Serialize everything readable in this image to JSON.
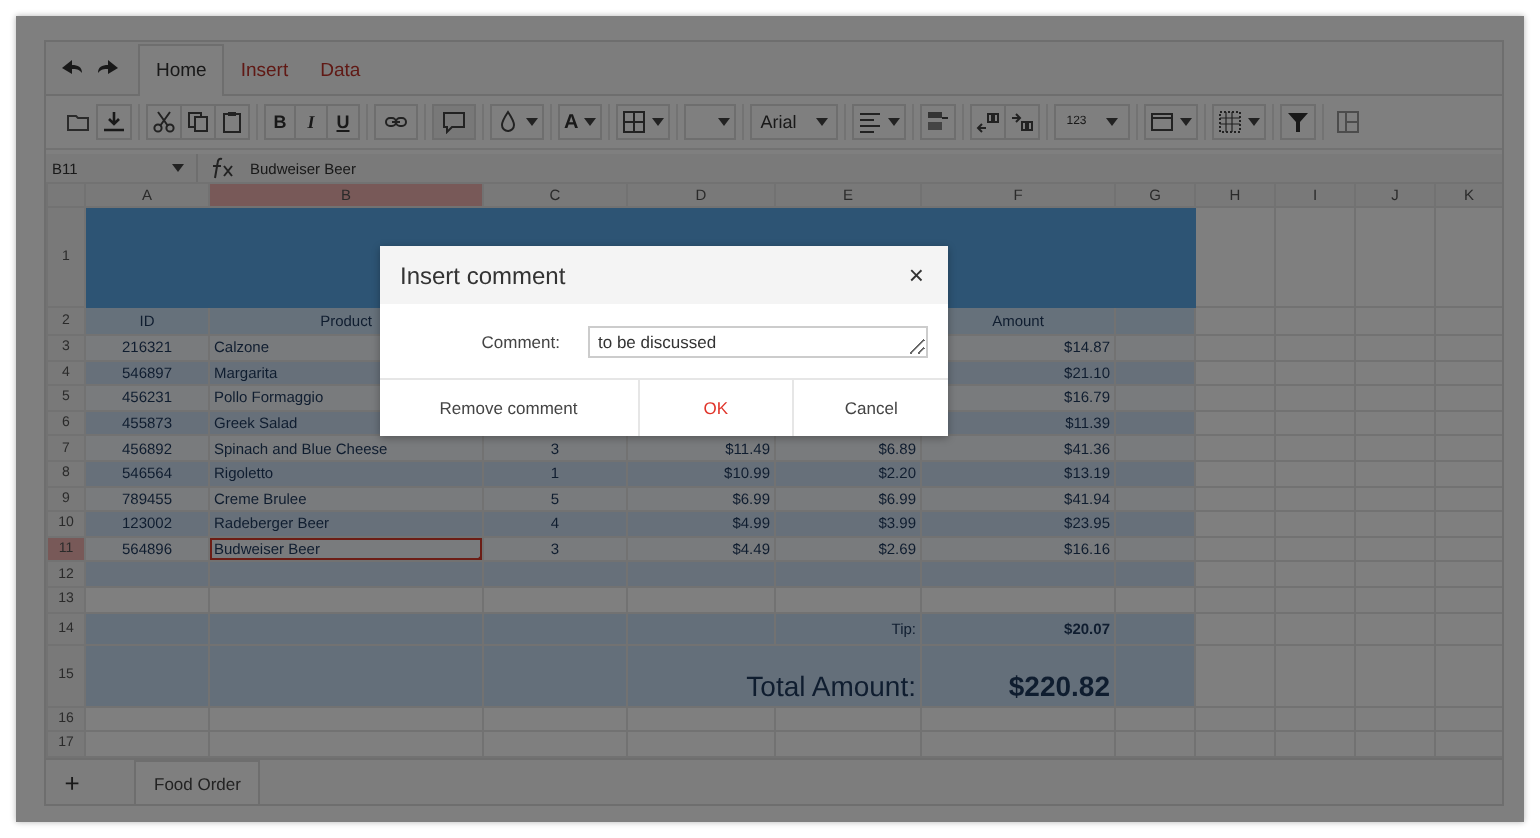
{
  "ribbon_tabs": [
    {
      "label": "Home",
      "selected": true
    },
    {
      "label": "Insert",
      "selected": false
    },
    {
      "label": "Data",
      "selected": false
    }
  ],
  "toolbar": {
    "bold": "B",
    "italic": "I",
    "underline": "U",
    "font_color": "A",
    "font_family": "Arial",
    "number_format": "123"
  },
  "formula_bar": {
    "cell": "B11",
    "formula": "Budweiser Beer"
  },
  "sheet": {
    "columns": [
      {
        "label": "A",
        "selected": false
      },
      {
        "label": "B",
        "selected": true
      },
      {
        "label": "C",
        "selected": false
      },
      {
        "label": "D",
        "selected": false
      },
      {
        "label": "E",
        "selected": false
      },
      {
        "label": "F",
        "selected": false
      },
      {
        "label": "G",
        "selected": false
      },
      {
        "label": "H",
        "selected": false
      },
      {
        "label": "I",
        "selected": false
      },
      {
        "label": "J",
        "selected": false
      },
      {
        "label": "K",
        "selected": false
      }
    ],
    "rows": [
      {
        "label": "1",
        "kind": "title",
        "selected": false,
        "cells": {}
      },
      {
        "label": "2",
        "kind": "header",
        "selected": false,
        "cells": {
          "id": "ID",
          "product": "Product",
          "amount": "Amount"
        }
      },
      {
        "label": "3",
        "kind": "data",
        "selected": false,
        "cells": {
          "id": "216321",
          "product": "Calzone",
          "amount": "$14.87"
        }
      },
      {
        "label": "4",
        "kind": "data",
        "selected": false,
        "cells": {
          "id": "546897",
          "product": "Margarita",
          "amount": "$21.10"
        }
      },
      {
        "label": "5",
        "kind": "data",
        "selected": false,
        "cells": {
          "id": "456231",
          "product": "Pollo Formaggio",
          "amount": "$16.79"
        }
      },
      {
        "label": "6",
        "kind": "data",
        "selected": false,
        "cells": {
          "id": "455873",
          "product": "Greek Salad",
          "amount": "$11.39"
        }
      },
      {
        "label": "7",
        "kind": "data",
        "selected": false,
        "cells": {
          "id": "456892",
          "product": "Spinach and Blue Cheese",
          "quantity": "3",
          "price": "$11.49",
          "tax": "$6.89",
          "amount": "$41.36"
        }
      },
      {
        "label": "8",
        "kind": "data",
        "selected": false,
        "cells": {
          "id": "546564",
          "product": "Rigoletto",
          "quantity": "1",
          "price": "$10.99",
          "tax": "$2.20",
          "amount": "$13.19"
        }
      },
      {
        "label": "9",
        "kind": "data",
        "selected": false,
        "cells": {
          "id": "789455",
          "product": "Creme Brulee",
          "quantity": "5",
          "price": "$6.99",
          "tax": "$6.99",
          "amount": "$41.94"
        }
      },
      {
        "label": "10",
        "kind": "data",
        "selected": false,
        "cells": {
          "id": "123002",
          "product": "Radeberger Beer",
          "quantity": "4",
          "price": "$4.99",
          "tax": "$3.99",
          "amount": "$23.95"
        }
      },
      {
        "label": "11",
        "kind": "data",
        "selected": true,
        "cells": {
          "id": "564896",
          "product": "Budweiser Beer",
          "quantity": "3",
          "price": "$4.49",
          "tax": "$2.69",
          "amount": "$16.16"
        }
      },
      {
        "label": "12",
        "kind": "data",
        "selected": false,
        "cells": {}
      },
      {
        "label": "13",
        "kind": "empty",
        "selected": false,
        "cells": {}
      },
      {
        "label": "14",
        "kind": "summary",
        "selected": false,
        "cells": {
          "summary_label": "Tip:",
          "summary_value": "$20.07"
        }
      },
      {
        "label": "15",
        "kind": "total",
        "selected": false,
        "cells": {
          "summary_label": "Total Amount:",
          "summary_value": "$220.82"
        }
      },
      {
        "label": "16",
        "kind": "empty",
        "selected": false,
        "cells": {}
      },
      {
        "label": "17",
        "kind": "empty",
        "selected": false,
        "cells": {}
      }
    ]
  },
  "sheet_tabs": {
    "add": "+",
    "tabs": [
      {
        "label": "Food Order",
        "selected": true
      }
    ]
  },
  "dialog": {
    "title": "Insert comment",
    "close": "×",
    "field_label": "Comment:",
    "field_value": "to be discussed",
    "buttons": [
      {
        "label": "Remove comment",
        "primary": false
      },
      {
        "label": "OK",
        "primary": true
      },
      {
        "label": "Cancel",
        "primary": false
      }
    ]
  }
}
